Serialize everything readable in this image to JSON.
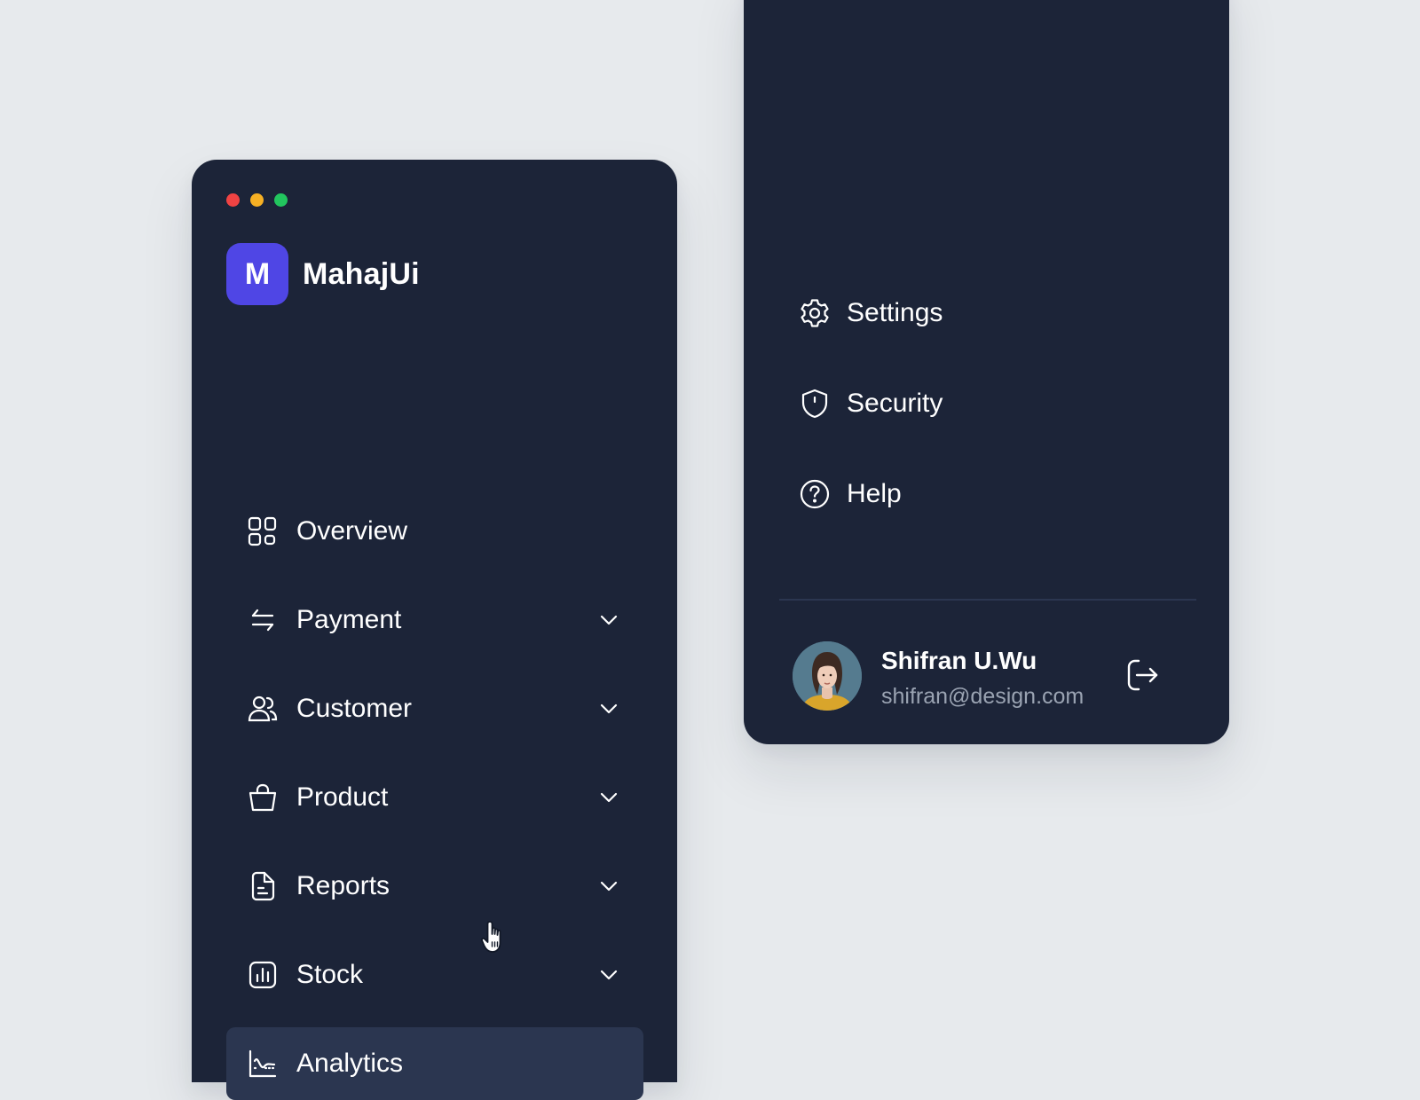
{
  "brand": {
    "logo_letter": "M",
    "name": "MahajUi",
    "logo_color": "#4f46e5"
  },
  "window_controls": [
    "close",
    "minimize",
    "maximize"
  ],
  "colors": {
    "panel_bg": "#1c2438",
    "page_bg": "#e7eaed",
    "active_item_bg": "#2b3650",
    "muted_text": "#9aa3b2"
  },
  "nav": {
    "items": [
      {
        "label": "Overview",
        "icon": "grid-icon",
        "has_chevron": false,
        "active": false
      },
      {
        "label": "Payment",
        "icon": "transfer-arrows-icon",
        "has_chevron": true,
        "active": false
      },
      {
        "label": "Customer",
        "icon": "users-icon",
        "has_chevron": true,
        "active": false
      },
      {
        "label": "Product",
        "icon": "shopping-bag-icon",
        "has_chevron": true,
        "active": false
      },
      {
        "label": "Reports",
        "icon": "document-icon",
        "has_chevron": true,
        "active": false
      },
      {
        "label": "Stock",
        "icon": "bar-chart-icon",
        "has_chevron": true,
        "active": false
      },
      {
        "label": "Analytics",
        "icon": "line-chart-icon",
        "has_chevron": false,
        "active": true
      }
    ]
  },
  "secondary_nav": {
    "items": [
      {
        "label": "Settings",
        "icon": "gear-icon"
      },
      {
        "label": "Security",
        "icon": "shield-icon"
      },
      {
        "label": "Help",
        "icon": "help-circle-icon"
      }
    ]
  },
  "user": {
    "name": "Shifran U.Wu",
    "email": "shifran@design.com",
    "logout_icon": "logout-icon"
  }
}
